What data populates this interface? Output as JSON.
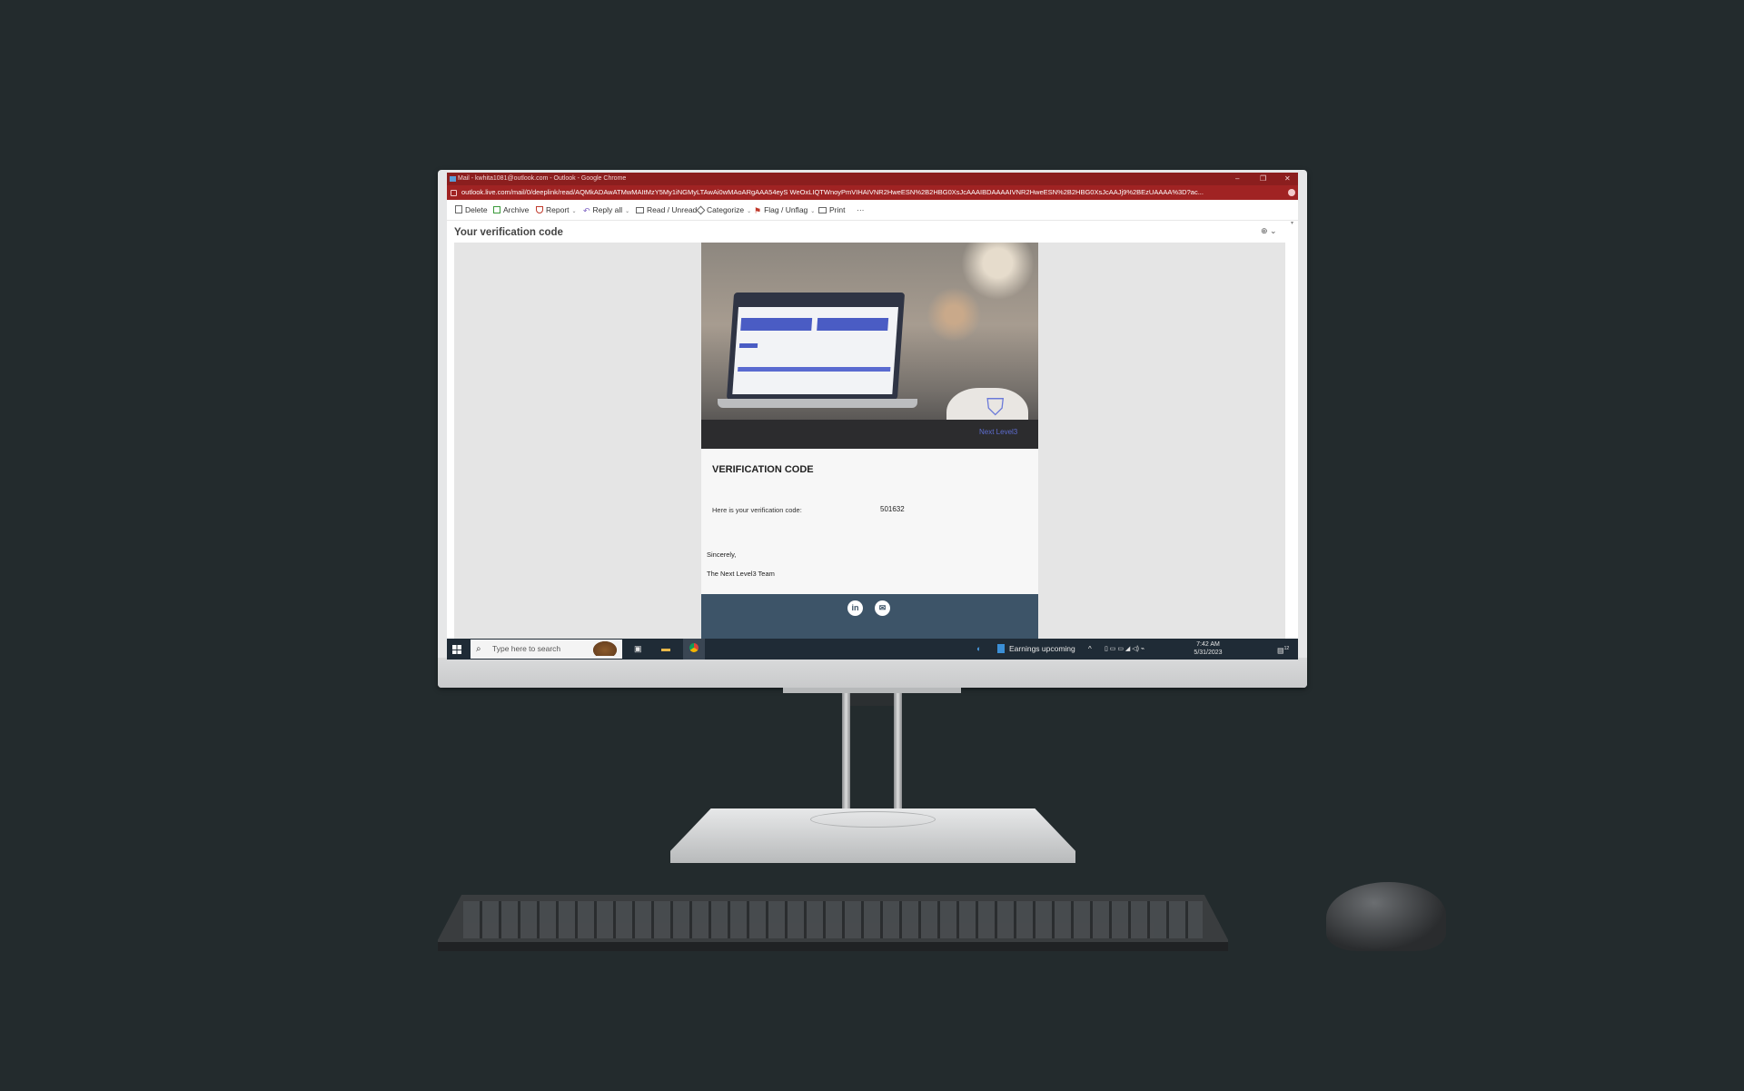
{
  "window": {
    "title": "Mail - kwhita1081@outlook.com - Outlook - Google Chrome",
    "controls": [
      "–",
      "❐",
      "✕"
    ]
  },
  "address": {
    "url": "outlook.live.com/mail/0/deeplink/read/AQMkADAwATMwMAItMzY5My1iNGMyLTAwAi0wMAoARgAAA54eyS WeOxLIQTWnoyPmVIHAIVNR2HweESN%2B2HBG0XsJcAAAIBDAAAAIVNR2HweESN%2B2HBG0XsJcAAJj9%2BEzUAAAA%3D?ac..."
  },
  "toolbar": {
    "delete": "Delete",
    "archive": "Archive",
    "report": "Report",
    "reply_all": "Reply all",
    "read_unread": "Read / Unread",
    "categorize": "Categorize",
    "flag": "Flag / Unflag",
    "print": "Print",
    "more": "···"
  },
  "mail": {
    "subject": "Your verification code",
    "zoom_icon": "⊕ ⌄"
  },
  "email_body": {
    "hero_logo": "Next Level3",
    "heading": "VERIFICATION CODE",
    "code_label": "Here is your verification code:",
    "code": "501632",
    "sincerely": "Sincerely,",
    "team": "The Next Level3 Team",
    "footer_icons": [
      "linkedin-icon",
      "mail-icon"
    ],
    "linkedin_glyph": "in",
    "mail_glyph": "✉"
  },
  "taskbar": {
    "search_placeholder": "Type here to search",
    "weather": "Earnings upcoming",
    "time": "7:42 AM",
    "date": "5/31/2023",
    "notification_count": "12"
  },
  "colors": {
    "chrome_titlebar": "#8b1e1e",
    "chrome_address": "#a02323",
    "taskbar": "#1f2b36",
    "email_footer": "#3d5468",
    "background": "#232b2d"
  }
}
